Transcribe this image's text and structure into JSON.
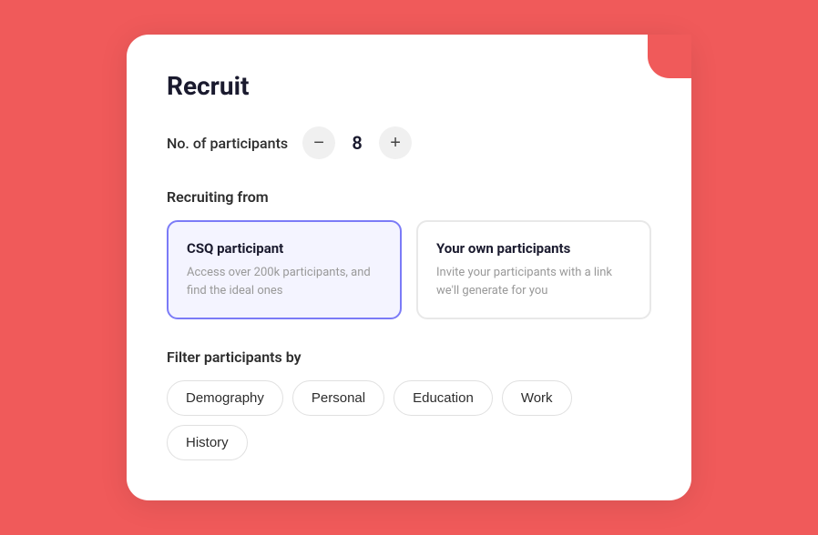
{
  "card": {
    "title": "Recruit",
    "participants": {
      "label": "No. of participants",
      "value": "8",
      "decrement_label": "−",
      "increment_label": "+"
    },
    "recruiting_section": {
      "label": "Recruiting from",
      "options": [
        {
          "id": "csq",
          "title": "CSQ participant",
          "description": "Access over 200k participants, and find the ideal ones",
          "selected": true
        },
        {
          "id": "own",
          "title": "Your own participants",
          "description": "Invite your participants with a link we'll generate for you",
          "selected": false
        }
      ]
    },
    "filter_section": {
      "label": "Filter participants by",
      "tags": [
        {
          "id": "demography",
          "label": "Demography"
        },
        {
          "id": "personal",
          "label": "Personal"
        },
        {
          "id": "education",
          "label": "Education"
        },
        {
          "id": "work",
          "label": "Work"
        },
        {
          "id": "history",
          "label": "History"
        }
      ]
    }
  }
}
